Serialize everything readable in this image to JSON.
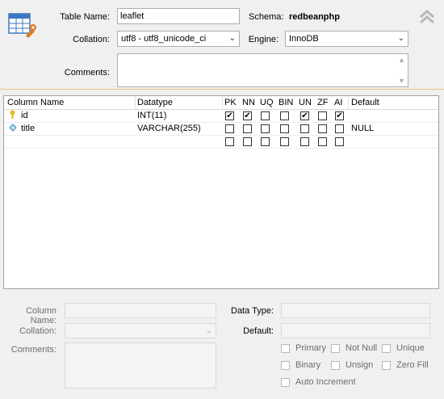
{
  "header": {
    "table_name_label": "Table Name:",
    "table_name_value": "leaflet",
    "schema_label": "Schema:",
    "schema_value": "redbeanphp",
    "collation_label": "Collation:",
    "collation_value": "utf8 - utf8_unicode_ci",
    "engine_label": "Engine:",
    "engine_value": "InnoDB",
    "comments_label": "Comments:",
    "comments_value": ""
  },
  "grid": {
    "headers": [
      "Column Name",
      "Datatype",
      "PK",
      "NN",
      "UQ",
      "BIN",
      "UN",
      "ZF",
      "AI",
      "Default"
    ],
    "rows": [
      {
        "name": "id",
        "icon": "key-icon",
        "datatype": "INT(11)",
        "pk": true,
        "nn": true,
        "uq": false,
        "bin": false,
        "un": true,
        "zf": false,
        "ai": true,
        "default": ""
      },
      {
        "name": "title",
        "icon": "diamond-icon",
        "datatype": "VARCHAR(255)",
        "pk": false,
        "nn": false,
        "uq": false,
        "bin": false,
        "un": false,
        "zf": false,
        "ai": false,
        "default": "NULL"
      },
      {
        "name": "",
        "icon": "",
        "datatype": "",
        "pk": false,
        "nn": false,
        "uq": false,
        "bin": false,
        "un": false,
        "zf": false,
        "ai": false,
        "default": ""
      }
    ]
  },
  "details": {
    "column_name_label": "Column Name:",
    "data_type_label": "Data Type:",
    "collation_label": "Collation:",
    "default_label": "Default:",
    "comments_label": "Comments:",
    "checks": [
      "Primary",
      "Not Null",
      "Unique",
      "Binary",
      "Unsign",
      "Zero Fill",
      "Auto Increment"
    ]
  },
  "colors": {
    "accent_border": "#f0c080",
    "field_border": "#abadb3"
  }
}
